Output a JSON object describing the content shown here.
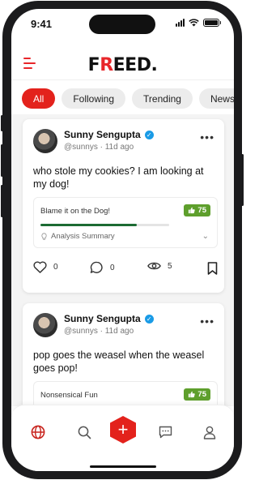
{
  "status_bar": {
    "time": "9:41"
  },
  "header": {
    "logo_prefix": "F",
    "logo_accent": "R",
    "logo_suffix": "EED."
  },
  "tabs": [
    {
      "label": "All",
      "active": true
    },
    {
      "label": "Following",
      "active": false
    },
    {
      "label": "Trending",
      "active": false
    },
    {
      "label": "News",
      "active": false
    }
  ],
  "posts": [
    {
      "author": "Sunny Sengupta",
      "handle_time": "@sunnys · 11d ago",
      "text": "who stole my cookies? I am looking at my dog!",
      "analysis_title": "Blame it on the Dog!",
      "score": "75",
      "score_fraction": 0.75,
      "summary_label": "Analysis Summary",
      "likes": "0",
      "comments": "0",
      "views": "5"
    },
    {
      "author": "Sunny Sengupta",
      "handle_time": "@sunnys · 11d ago",
      "text": "pop goes the weasel when the weasel goes pop!",
      "analysis_title": "Nonsensical Fun",
      "score": "75"
    }
  ],
  "bottom_nav": {
    "items": [
      "globe-icon",
      "search-icon",
      "add-icon",
      "chat-icon",
      "profile-icon"
    ]
  },
  "colors": {
    "accent": "#e3221c",
    "score_badge": "#5e9f2c",
    "progress": "#1c6b33",
    "verified": "#1a9be6"
  }
}
